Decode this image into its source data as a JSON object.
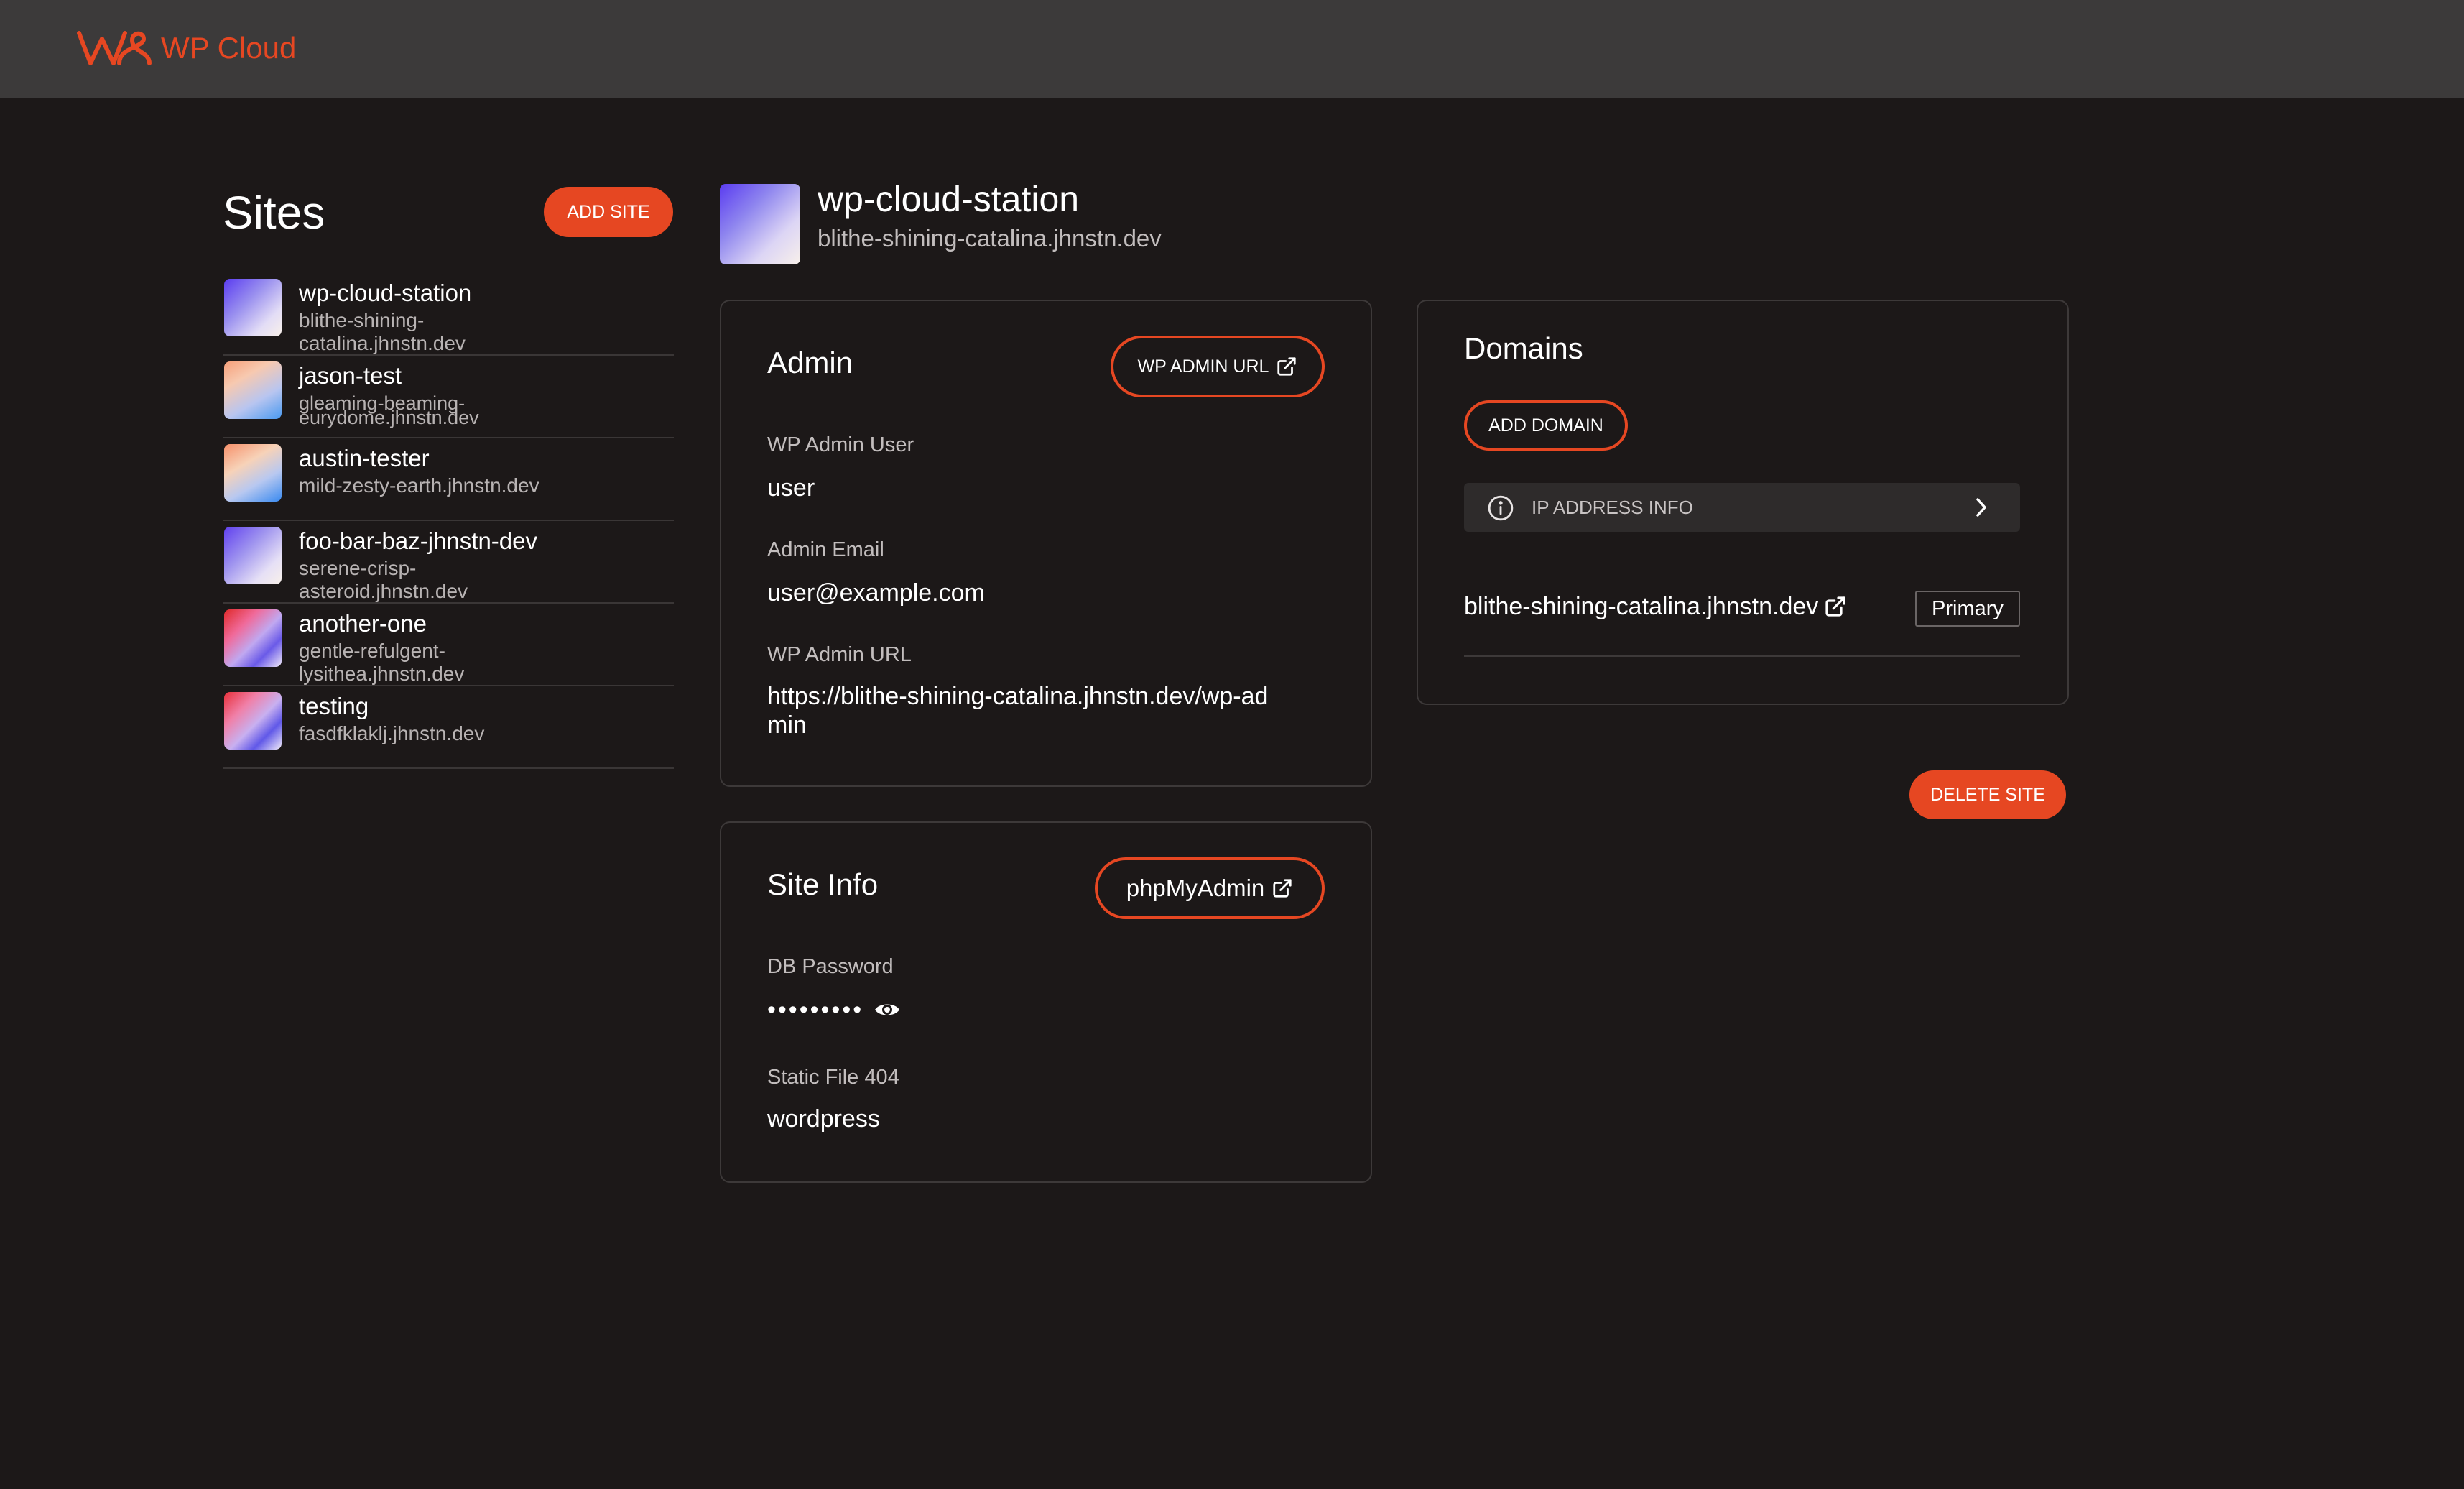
{
  "app": {
    "name": "WP Cloud",
    "brand_color": "#e64722"
  },
  "sidebar": {
    "title": "Sites",
    "add_site_label": "ADD SITE",
    "sites": [
      {
        "name": "wp-cloud-station",
        "domain": "blithe-shining-catalina.jhnstn.dev"
      },
      {
        "name": "jason-test",
        "domain": "gleaming-beaming-eurydome.jhnstn.dev"
      },
      {
        "name": "austin-tester",
        "domain": "mild-zesty-earth.jhnstn.dev"
      },
      {
        "name": "foo-bar-baz-jhnstn-dev",
        "domain": "serene-crisp-asteroid.jhnstn.dev"
      },
      {
        "name": "another-one",
        "domain": "gentle-refulgent-lysithea.jhnstn.dev"
      },
      {
        "name": "testing",
        "domain": "fasdfklaklj.jhnstn.dev"
      }
    ]
  },
  "site": {
    "name": "wp-cloud-station",
    "domain": "blithe-shining-catalina.jhnstn.dev"
  },
  "admin": {
    "title": "Admin",
    "admin_url_button": "WP ADMIN URL",
    "user_label": "WP Admin User",
    "user_value": "user",
    "email_label": "Admin Email",
    "email_value": "user@example.com",
    "url_label": "WP Admin URL",
    "url_value": "https://blithe-shining-catalina.jhnstn.dev/wp-admin"
  },
  "site_info": {
    "title": "Site Info",
    "phpmyadmin_button": "phpMyAdmin",
    "db_password_label": "DB Password",
    "db_password_value": "•••••••••",
    "static_404_label": "Static File 404",
    "static_404_value": "wordpress"
  },
  "domains": {
    "title": "Domains",
    "add_domain_label": "ADD DOMAIN",
    "ip_info_label": "IP ADDRESS INFO",
    "items": [
      {
        "domain": "blithe-shining-catalina.jhnstn.dev",
        "badge": "Primary"
      }
    ]
  },
  "actions": {
    "delete_site_label": "DELETE SITE"
  },
  "icons": {
    "logo": "wp-cloud-logo-icon",
    "external": "external-link-icon",
    "info": "info-icon",
    "chevron": "chevron-right-icon",
    "eye": "eye-icon"
  }
}
